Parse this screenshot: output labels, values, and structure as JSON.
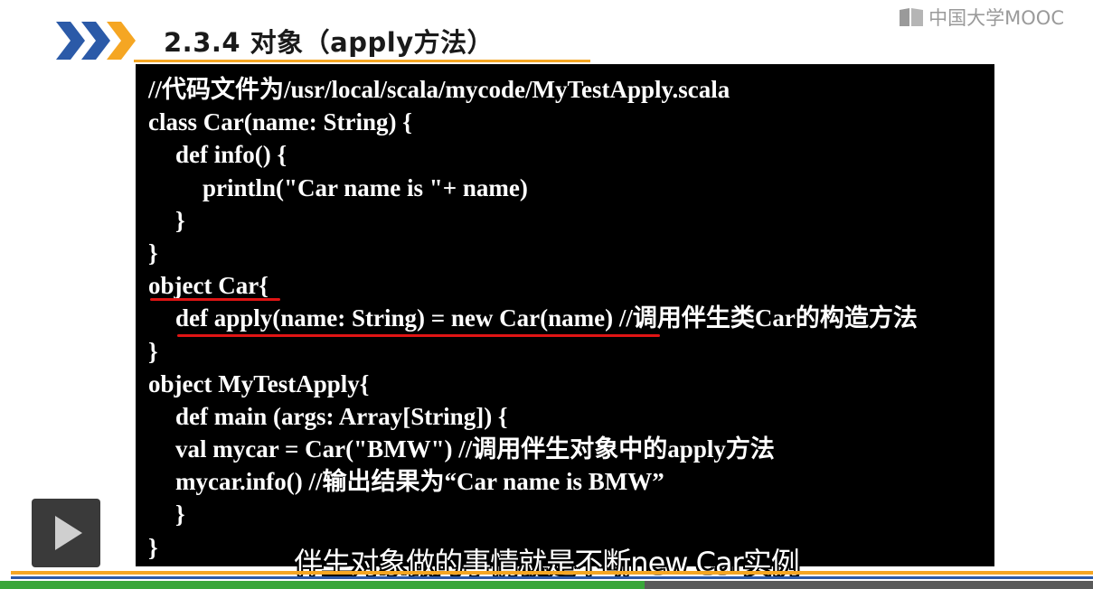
{
  "slide": {
    "title": "2.3.4  对象（apply方法）",
    "logo_text": "中国大学MOOC"
  },
  "code": {
    "lines": [
      "//代码文件为/usr/local/scala/mycode/MyTestApply.scala",
      "class Car(name: String) {",
      "def info() {",
      "println(\"Car name is \"+ name)",
      "}",
      "}",
      "object Car{",
      "def apply(name: String) = new Car(name) //调用伴生类Car的构造方法",
      "}",
      "object MyTestApply{",
      "def main (args: Array[String]) {",
      "val mycar = Car(\"BMW\") //调用伴生对象中的apply方法",
      "mycar.info() //输出结果为“Car name is BMW”",
      "}",
      "}"
    ],
    "indents": [
      0,
      0,
      1,
      2,
      1,
      0,
      0,
      1,
      0,
      0,
      1,
      1,
      1,
      1,
      0
    ]
  },
  "player": {
    "subtitle": "伴生对象做的事情就是不断new Car实例",
    "progress": 0.59,
    "icons": [
      "play-icon"
    ]
  },
  "colors": {
    "accent_orange": "#f5a623",
    "accent_blue": "#2b5aa8",
    "chevron_blue": "#2b5aa8",
    "underline_red": "#e01414",
    "progress_green": "#3aa63a"
  }
}
